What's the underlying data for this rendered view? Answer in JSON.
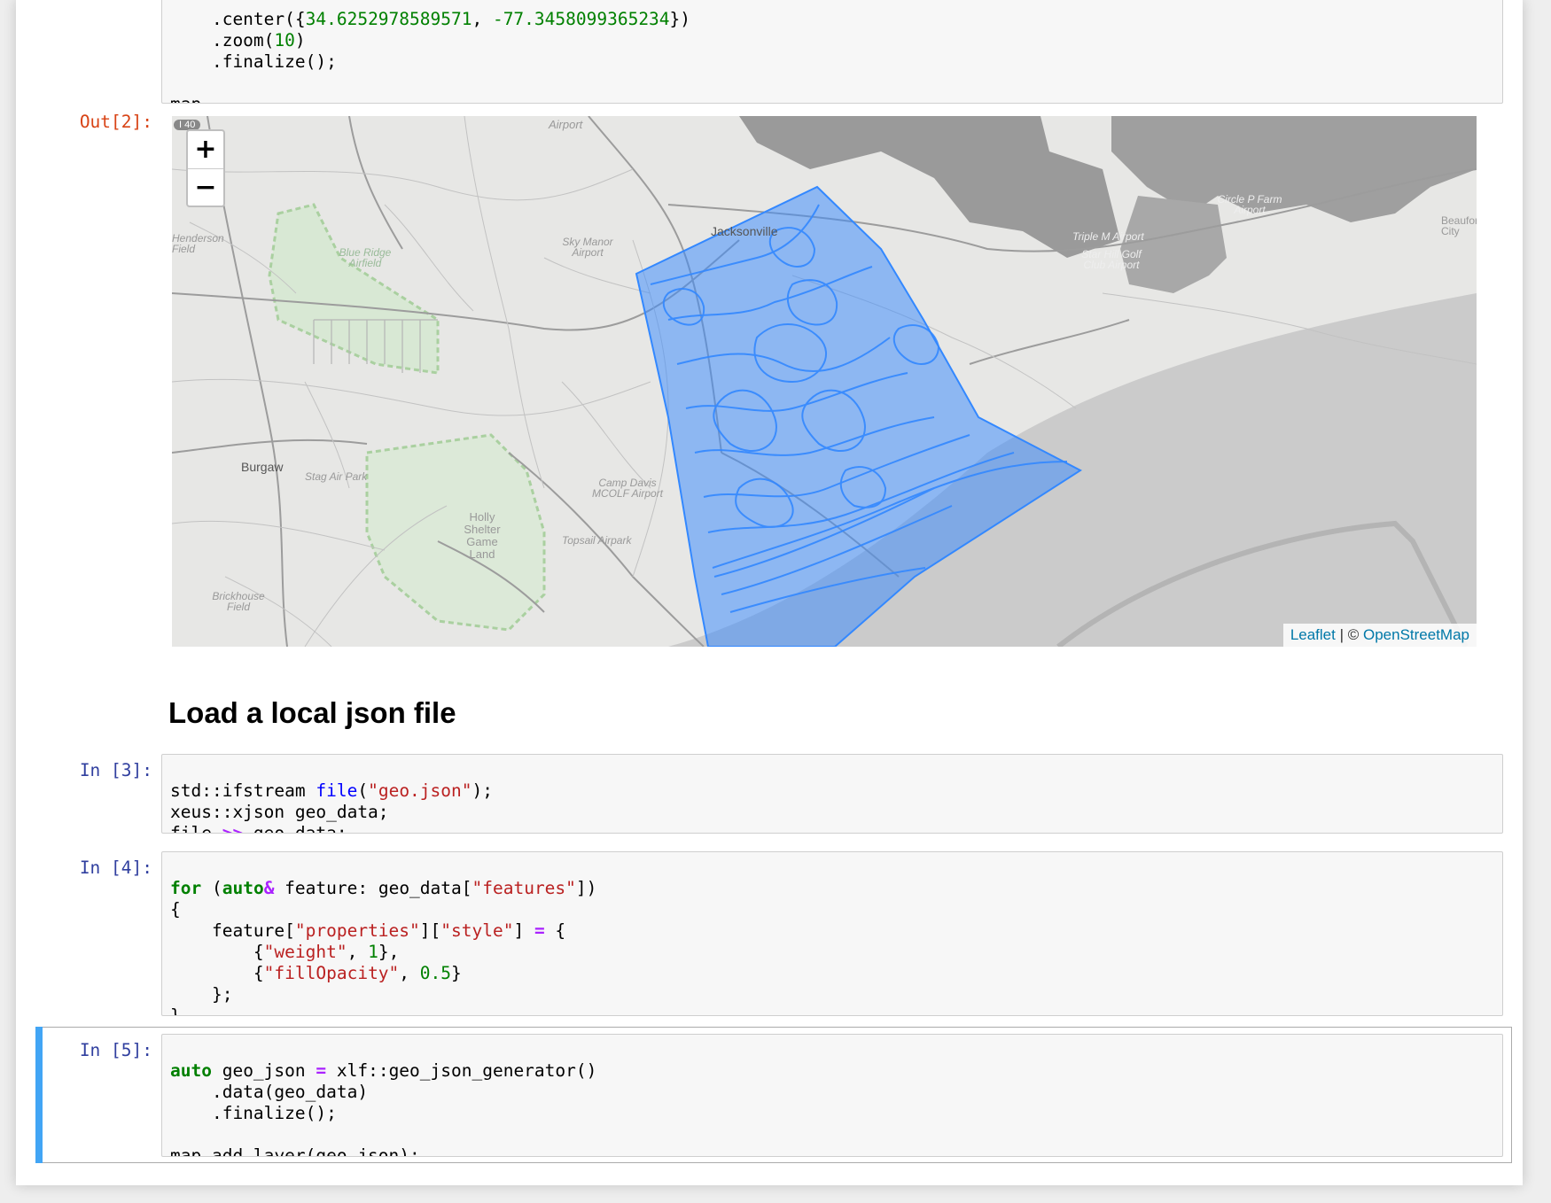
{
  "cell2": {
    "code_line_0_prefix": "    .center({",
    "code_line_0_num1": "34.6252978589571",
    "code_line_0_sep": ", ",
    "code_line_0_num2": "-77.3458099365234",
    "code_line_0_suffix": "})",
    "code_line_1_prefix": "    .zoom(",
    "code_line_1_num": "10",
    "code_line_1_suffix": ")",
    "code_line_2": "    .finalize();",
    "code_line_4": "map"
  },
  "out2": {
    "prompt": "Out[2]:"
  },
  "map": {
    "zoom_in": "+",
    "zoom_out": "−",
    "road_shield": "I 40",
    "labels": {
      "airport": "Airport",
      "jacksonville": "Jacksonville",
      "henderson": "Henderson Field",
      "blue_ridge": "Blue Ridge Airfield",
      "sky_manor": "Sky Manor Airport",
      "circle_p": "Circle P Farm Airport",
      "triple_m": "Triple M Airport",
      "star_hill": "Star Hill Golf Club Airport",
      "beaufort": "Beaufort City",
      "burgaw": "Burgaw",
      "stag_air": "Stag Air Park",
      "camp_davis": "Camp Davis MCOLF Airport",
      "holly": "Holly Shelter Game Land",
      "topsail": "Topsail Airpark",
      "brickhouse": "Brickhouse Field"
    },
    "attribution_leaflet": "Leaflet",
    "attribution_sep": " | © ",
    "attribution_osm": "OpenStreetMap",
    "overlay_color": "#3388ff"
  },
  "markdown": {
    "heading": "Load a local json file"
  },
  "cell3": {
    "prompt": "In [3]:",
    "l1_a": "std::ifstream ",
    "l1_f": "file",
    "l1_b": "(",
    "l1_s": "\"geo.json\"",
    "l1_c": ");",
    "l2": "xeus::xjson geo_data;",
    "l3_a": "file ",
    "l3_op": ">>",
    "l3_b": " geo_data;"
  },
  "cell4": {
    "prompt": "In [4]:",
    "l1_for": "for",
    "l1_a": " (",
    "l1_auto": "auto",
    "l1_amp": "&",
    "l1_b": " feature: geo_data[",
    "l1_s": "\"features\"",
    "l1_c": "])",
    "l2": "{",
    "l3_a": "    feature[",
    "l3_s1": "\"properties\"",
    "l3_b": "][",
    "l3_s2": "\"style\"",
    "l3_c": "] ",
    "l3_eq": "=",
    "l3_d": " {",
    "l4_a": "        {",
    "l4_s": "\"weight\"",
    "l4_b": ", ",
    "l4_n": "1",
    "l4_c": "},",
    "l5_a": "        {",
    "l5_s": "\"fillOpacity\"",
    "l5_b": ", ",
    "l5_n": "0.5",
    "l5_c": "}",
    "l6": "    };",
    "l7": "}"
  },
  "cell5": {
    "prompt": "In [5]:",
    "l1_auto": "auto",
    "l1_a": " geo_json ",
    "l1_eq": "=",
    "l1_b": " xlf::geo_json_generator()",
    "l2": "    .data(geo_data)",
    "l3": "    .finalize();",
    "l5": "map.add_layer(geo_json);"
  }
}
